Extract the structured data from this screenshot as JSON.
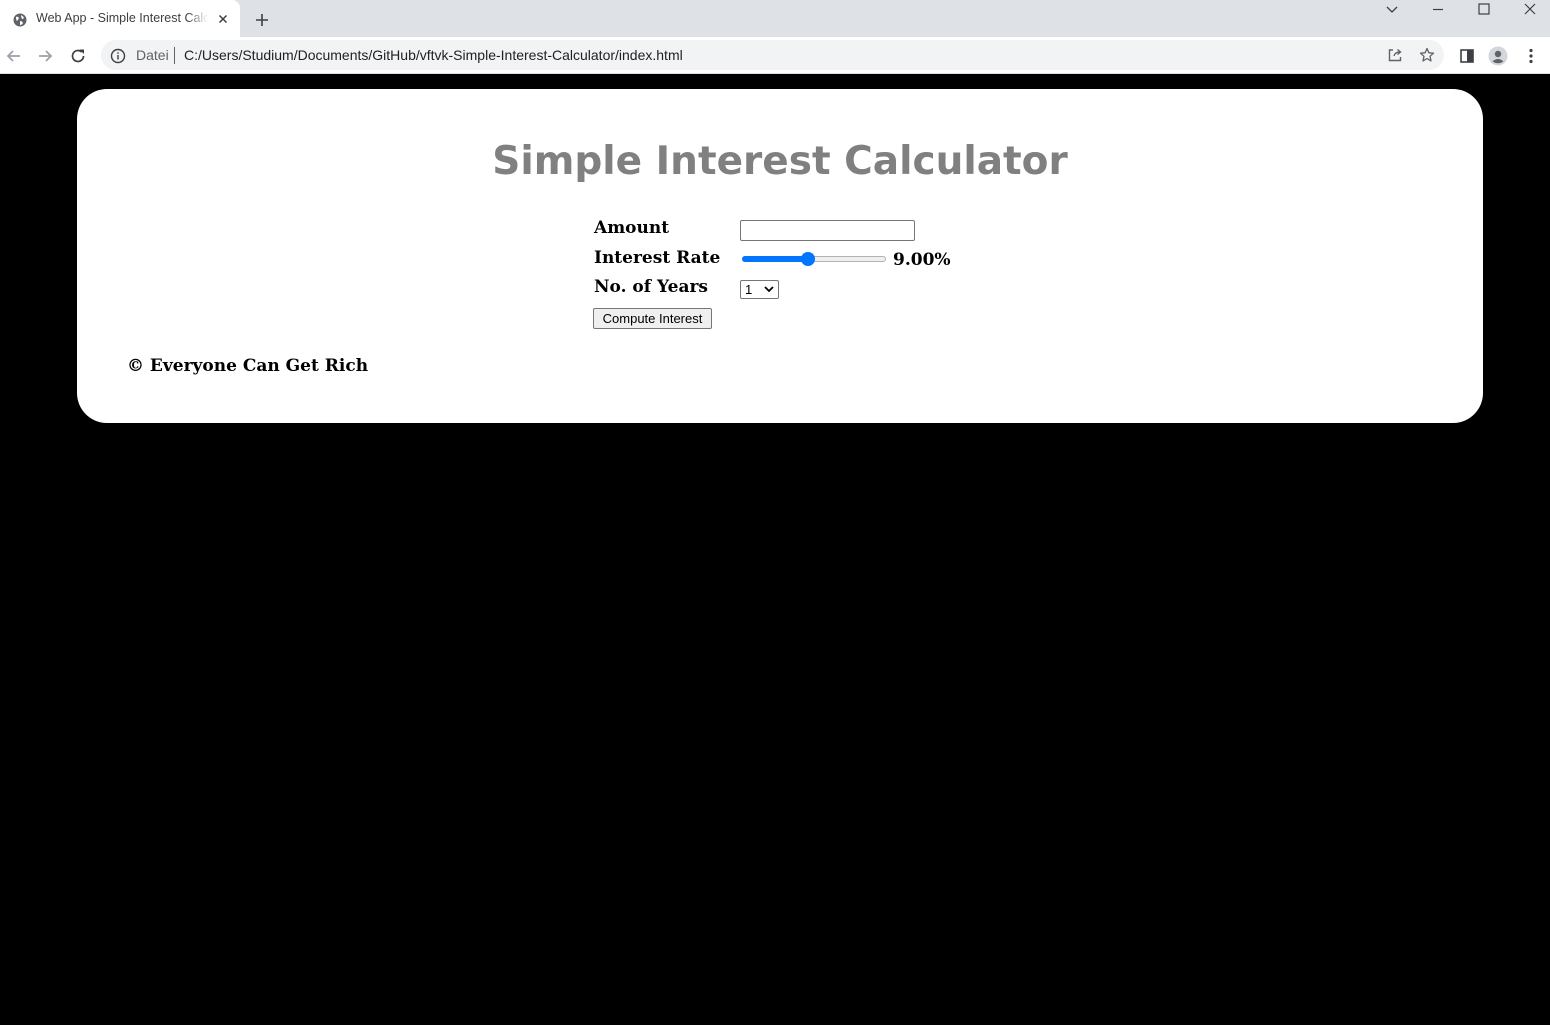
{
  "browser": {
    "tab_title": "Web App - Simple Interest Calculator",
    "omnibox": {
      "security_chip": "Datei",
      "url": "C:/Users/Studium/Documents/GitHub/vftvk-Simple-Interest-Calculator/index.html"
    },
    "icons": {
      "tab_favicon": "globe-icon",
      "tab_close": "close-icon",
      "new_tab": "plus-icon",
      "tab_search": "chevron-down-icon",
      "minimize": "minimize-icon",
      "maximize": "maximize-icon",
      "close_window": "close-icon",
      "back": "arrow-left-icon",
      "forward": "arrow-right-icon",
      "reload": "reload-icon",
      "site_info": "info-icon",
      "share": "share-icon",
      "bookmark": "star-icon",
      "side_panel": "side-panel-icon",
      "profile": "avatar-icon",
      "menu": "kebab-menu-icon"
    }
  },
  "page": {
    "title": "Simple Interest Calculator",
    "form": {
      "amount_label": "Amount",
      "amount_value": "",
      "rate_label": "Interest Rate",
      "rate_slider_fraction": 0.45,
      "rate_display": "9.00%",
      "years_label": "No. of Years",
      "years_selected": "1",
      "compute_button": "Compute Interest"
    },
    "footer": "© Everyone Can Get Rich"
  },
  "colors": {
    "page_background": "#000000",
    "card_background": "#ffffff",
    "title_color": "#808080",
    "slider_accent": "#0075ff"
  }
}
